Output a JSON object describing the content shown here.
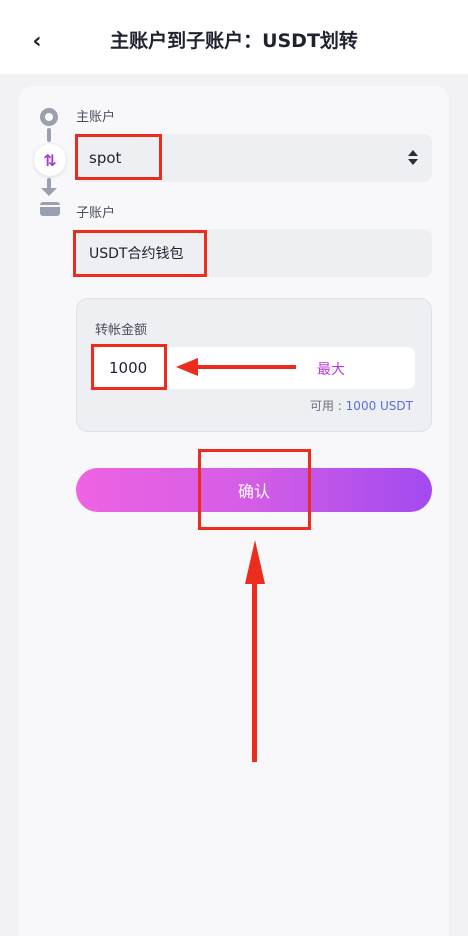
{
  "header": {
    "back_icon": "‹",
    "title": "主账户到子账户：USDT划转"
  },
  "transfer": {
    "from_label": "主账户",
    "from_value": "spot",
    "swap_icon": "⇅",
    "to_label": "子账户",
    "to_value": "USDT合约钱包"
  },
  "amount": {
    "label": "转帐金额",
    "value": "1000",
    "max_label": "最大",
    "available_label": "可用 : ",
    "available_value": "1000 USDT"
  },
  "confirm_label": "确认",
  "colors": {
    "annotation": "#ec2c1c",
    "accent_purple": "#b83ad6",
    "available_blue": "#5a6de0"
  }
}
